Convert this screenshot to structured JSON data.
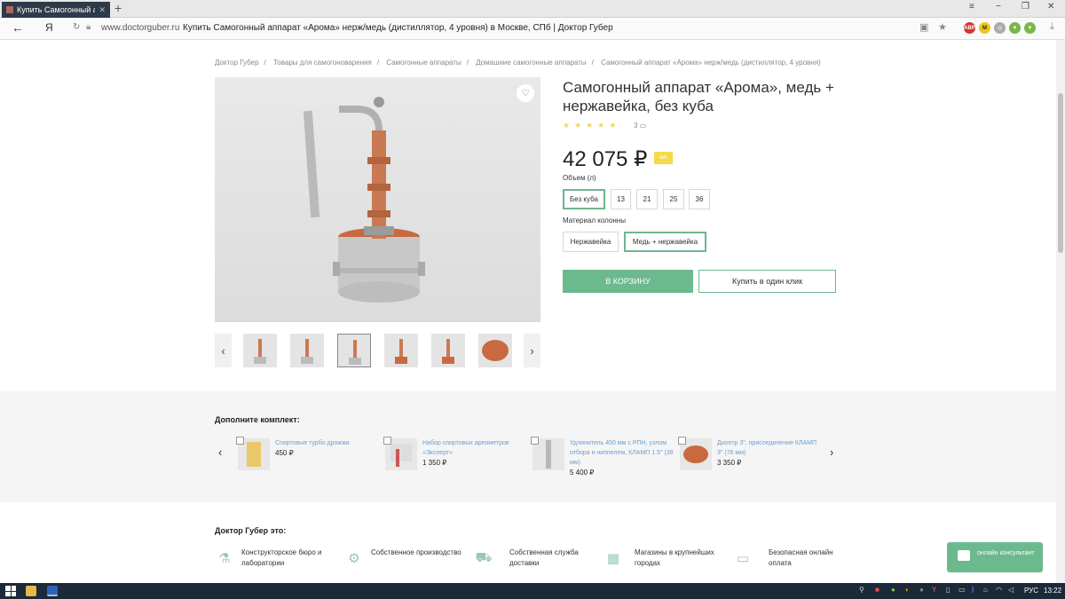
{
  "browser": {
    "tab_title": "Купить Самогонный ап",
    "tab_close": "✕",
    "new_tab": "+",
    "window_controls": [
      "≡",
      "−",
      "❐",
      "✕"
    ],
    "back": "←",
    "yandex_logo": "Я",
    "url": "www.doctorguber.ru",
    "page_title": "Купить Самогонный аппарат «Арома» нерж/медь (дистиллятор, 4 уровня) в Москве, СПб | Доктор Губер",
    "extensions": [
      "ABP",
      "M"
    ]
  },
  "breadcrumb": [
    "Доктор Губер",
    "Товары для самогоноварения",
    "Самогонные аппараты",
    "Домашние самогонные аппараты",
    "Самогонный аппарат «Арома» нерж/медь (дистиллятор, 4 уровня)"
  ],
  "product": {
    "title": "Самогонный аппарат «Арома», медь + нержавейка, без куба",
    "stars": "★★★★★",
    "reviews": "3",
    "price": "42 075 ₽",
    "hit_badge": "хит",
    "volume_label": "Объем (л)",
    "volume_options": [
      "Без куба",
      "13",
      "21",
      "25",
      "36"
    ],
    "volume_selected": "Без куба",
    "material_label": "Материал колонны",
    "material_options": [
      "Нержавейка",
      "Медь + нержавейка"
    ],
    "material_selected": "Медь + нержавейка",
    "cart_button": "В КОРЗИНУ",
    "oneclick_button": "Купить в один клик"
  },
  "thumbnails": {
    "count": 6,
    "active_index": 2,
    "prev": "‹",
    "next": "›"
  },
  "complement": {
    "title": "Дополните комплект:",
    "prev": "‹",
    "next": "›",
    "items": [
      {
        "name": "Спиртовые турбо дрожжи",
        "price": "450 ₽"
      },
      {
        "name": "Набор спиртовых ареометров «Эксперт»",
        "price": "1 350 ₽"
      },
      {
        "name": "Удлинитель 450 мм с РПН, узлом отбора и ниппелем, КЛАМП 1.5\" (38 мм)",
        "price": "5 400 ₽"
      },
      {
        "name": "Диоптр 3\", присоединение КЛАМП 3\" (76 мм)",
        "price": "3 350 ₽"
      }
    ]
  },
  "about": {
    "title": "Доктор Губер это:",
    "features": [
      {
        "text": "Конструкторское бюро и лаборатории",
        "icon": "lab-icon"
      },
      {
        "text": "Собственное производство",
        "icon": "production-icon"
      },
      {
        "text": "Собственная служба доставки",
        "icon": "truck-icon"
      },
      {
        "text": "Магазины в крупнейших городах",
        "icon": "store-icon"
      },
      {
        "text": "Безопасная онлайн оплата",
        "icon": "card-icon"
      }
    ]
  },
  "consultant": {
    "label": "онлайн консультант"
  },
  "taskbar": {
    "lang": "РУС",
    "time": "13:22"
  },
  "colors": {
    "accent_green": "#6cb98e",
    "hit_yellow": "#f5d94b",
    "link_blue": "#6a9fd0",
    "taskbar": "#1c2939"
  }
}
